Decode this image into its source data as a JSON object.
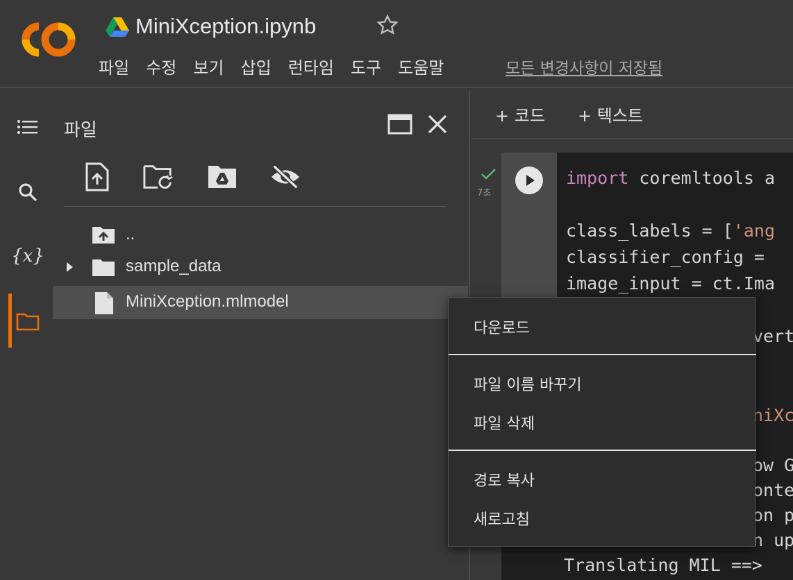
{
  "header": {
    "notebook_title": "MiniXception.ipynb",
    "menu": [
      "파일",
      "수정",
      "보기",
      "삽입",
      "런타임",
      "도구",
      "도움말"
    ],
    "save_status": "모든 변경사항이 저장됨"
  },
  "rail": {
    "items": [
      "toc-icon",
      "search-icon",
      "variables-icon",
      "folder-icon"
    ],
    "variables_label": "{x}"
  },
  "files_panel": {
    "title": "파일",
    "tree": [
      {
        "label": "..",
        "icon": "folder-up-icon"
      },
      {
        "label": "sample_data",
        "icon": "folder-icon"
      },
      {
        "label": "MiniXception.mlmodel",
        "icon": "file-icon"
      }
    ]
  },
  "notebook": {
    "add_code": "+ 코드",
    "add_text": "+ 텍스트",
    "exec_time": "7초",
    "code_lines": [
      {
        "kw": "import",
        "rest": " coremltools a"
      },
      {
        "text": ""
      },
      {
        "text": "class_labels = [",
        "str": "'ang"
      },
      {
        "text": "classifier_config = "
      },
      {
        "text": "image_input = ct.Ima"
      },
      {
        "text": "vert"
      },
      {
        "str": "niXc"
      }
    ],
    "output_lines": [
      "ow G",
      "onte",
      "on p",
      "n up",
      "Translating MIL ==> "
    ]
  },
  "context_menu": {
    "items": [
      "다운로드",
      "파일 이름 바꾸기",
      "파일 삭제",
      "경로 복사",
      "새로고침"
    ]
  },
  "colors": {
    "accent": "#e8710a",
    "background": "#383838",
    "menu_bg": "#2d2d2d"
  }
}
